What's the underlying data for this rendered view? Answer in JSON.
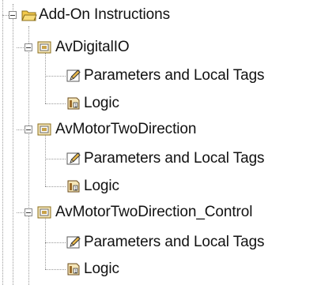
{
  "tree": {
    "root": {
      "label": "Add-On Instructions",
      "icon": "folder-open-icon",
      "expanded": true
    },
    "items": [
      {
        "label": "AvDigitalIO",
        "icon": "add-on-instruction-icon",
        "expanded": true,
        "children": [
          {
            "label": "Parameters and Local Tags",
            "icon": "pencil-tags-icon"
          },
          {
            "label": "Logic",
            "icon": "logic-routine-icon"
          }
        ]
      },
      {
        "label": "AvMotorTwoDirection",
        "icon": "add-on-instruction-icon",
        "expanded": true,
        "children": [
          {
            "label": "Parameters and Local Tags",
            "icon": "pencil-tags-icon"
          },
          {
            "label": "Logic",
            "icon": "logic-routine-icon"
          }
        ]
      },
      {
        "label": "AvMotorTwoDirection_Control",
        "icon": "add-on-instruction-icon",
        "expanded": true,
        "children": [
          {
            "label": "Parameters and Local Tags",
            "icon": "pencil-tags-icon"
          },
          {
            "label": "Logic",
            "icon": "logic-routine-icon"
          }
        ]
      }
    ]
  },
  "colors": {
    "tree_line": "#9a9a9a",
    "text": "#111111",
    "folder": "#f2c94c",
    "aoi_icon": "#c8a24a",
    "pencil": "#e8b84a",
    "logic": "#9a6a2a"
  }
}
